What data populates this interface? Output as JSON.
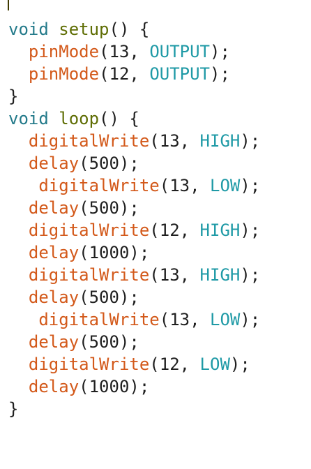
{
  "editor": {
    "lines": [
      {
        "segments": [
          {
            "text": "void",
            "role": "type"
          },
          {
            "text": " ",
            "role": "plain"
          },
          {
            "text": "setup",
            "role": "fn"
          },
          {
            "text": "() {",
            "role": "plain"
          }
        ]
      },
      {
        "segments": [
          {
            "text": "  ",
            "role": "plain"
          },
          {
            "text": "pinMode",
            "role": "call"
          },
          {
            "text": "(13, ",
            "role": "plain"
          },
          {
            "text": "OUTPUT",
            "role": "const"
          },
          {
            "text": ");",
            "role": "plain"
          }
        ]
      },
      {
        "segments": [
          {
            "text": "  ",
            "role": "plain"
          },
          {
            "text": "pinMode",
            "role": "call"
          },
          {
            "text": "(12, ",
            "role": "plain"
          },
          {
            "text": "OUTPUT",
            "role": "const"
          },
          {
            "text": ");",
            "role": "plain"
          }
        ]
      },
      {
        "segments": [
          {
            "text": "}",
            "role": "plain"
          }
        ]
      },
      {
        "segments": [
          {
            "text": "void",
            "role": "type"
          },
          {
            "text": " ",
            "role": "plain"
          },
          {
            "text": "loop",
            "role": "fn"
          },
          {
            "text": "() {",
            "role": "plain"
          }
        ]
      },
      {
        "segments": [
          {
            "text": "  ",
            "role": "plain"
          },
          {
            "text": "digitalWrite",
            "role": "call"
          },
          {
            "text": "(13, ",
            "role": "plain"
          },
          {
            "text": "HIGH",
            "role": "const"
          },
          {
            "text": ");",
            "role": "plain"
          }
        ]
      },
      {
        "segments": [
          {
            "text": "  ",
            "role": "plain"
          },
          {
            "text": "delay",
            "role": "call"
          },
          {
            "text": "(500);",
            "role": "plain"
          }
        ]
      },
      {
        "segments": [
          {
            "text": "   ",
            "role": "plain"
          },
          {
            "text": "digitalWrite",
            "role": "call"
          },
          {
            "text": "(13, ",
            "role": "plain"
          },
          {
            "text": "LOW",
            "role": "const"
          },
          {
            "text": ");",
            "role": "plain"
          }
        ]
      },
      {
        "segments": [
          {
            "text": "  ",
            "role": "plain"
          },
          {
            "text": "delay",
            "role": "call"
          },
          {
            "text": "(500);",
            "role": "plain"
          }
        ]
      },
      {
        "segments": [
          {
            "text": "  ",
            "role": "plain"
          },
          {
            "text": "digitalWrite",
            "role": "call"
          },
          {
            "text": "(12, ",
            "role": "plain"
          },
          {
            "text": "HIGH",
            "role": "const"
          },
          {
            "text": ");",
            "role": "plain"
          }
        ]
      },
      {
        "segments": [
          {
            "text": "  ",
            "role": "plain"
          },
          {
            "text": "delay",
            "role": "call"
          },
          {
            "text": "(1000);",
            "role": "plain"
          }
        ]
      },
      {
        "segments": [
          {
            "text": "  ",
            "role": "plain"
          },
          {
            "text": "digitalWrite",
            "role": "call"
          },
          {
            "text": "(13, ",
            "role": "plain"
          },
          {
            "text": "HIGH",
            "role": "const"
          },
          {
            "text": ");",
            "role": "plain"
          }
        ]
      },
      {
        "segments": [
          {
            "text": "  ",
            "role": "plain"
          },
          {
            "text": "delay",
            "role": "call"
          },
          {
            "text": "(500);",
            "role": "plain"
          }
        ]
      },
      {
        "segments": [
          {
            "text": "   ",
            "role": "plain"
          },
          {
            "text": "digitalWrite",
            "role": "call"
          },
          {
            "text": "(13, ",
            "role": "plain"
          },
          {
            "text": "LOW",
            "role": "const"
          },
          {
            "text": ");",
            "role": "plain"
          }
        ]
      },
      {
        "segments": [
          {
            "text": "  ",
            "role": "plain"
          },
          {
            "text": "delay",
            "role": "call"
          },
          {
            "text": "(500);",
            "role": "plain"
          }
        ]
      },
      {
        "segments": [
          {
            "text": "  ",
            "role": "plain"
          },
          {
            "text": "digitalWrite",
            "role": "call"
          },
          {
            "text": "(12, ",
            "role": "plain"
          },
          {
            "text": "LOW",
            "role": "const"
          },
          {
            "text": ");",
            "role": "plain"
          }
        ]
      },
      {
        "segments": [
          {
            "text": "  ",
            "role": "plain"
          },
          {
            "text": "delay",
            "role": "call"
          },
          {
            "text": "(1000);",
            "role": "plain"
          }
        ]
      },
      {
        "segments": [
          {
            "text": "}",
            "role": "plain"
          }
        ]
      }
    ]
  },
  "colors": {
    "type": "#237a8a",
    "fn": "#5e6d03",
    "call": "#d3591a",
    "const": "#1f9aa6",
    "plain": "#1f1f1f",
    "background": "#ffffff",
    "caret": "#3f3a00"
  }
}
